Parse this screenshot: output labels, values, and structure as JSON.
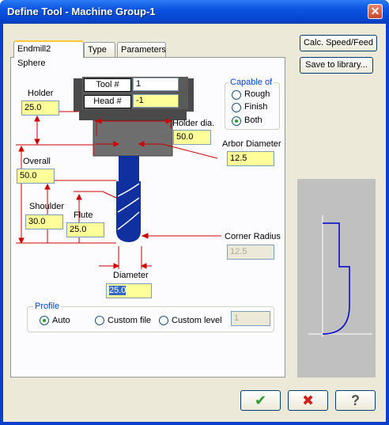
{
  "window": {
    "title": "Define Tool - Machine Group-1",
    "close_glyph": "✕"
  },
  "tabs": [
    {
      "label": "Endmill2 Sphere",
      "active": true
    },
    {
      "label": "Type",
      "active": false
    },
    {
      "label": "Parameters",
      "active": false
    }
  ],
  "tool_diagram": {
    "tool_number_label": "Tool #",
    "tool_number": "1",
    "head_number_label": "Head #",
    "head_number": "-1",
    "holder_label": "Holder",
    "holder": "25.0",
    "holder_dia_label": "Holder dia.",
    "holder_dia": "50.0",
    "arbor_label": "Arbor Diameter",
    "arbor": "12.5",
    "overall_label": "Overall",
    "overall": "50.0",
    "shoulder_label": "Shoulder",
    "shoulder": "30.0",
    "flute_label": "Flute",
    "flute": "25.0",
    "corner_radius_label": "Corner Radius",
    "corner_radius": "12.5",
    "diameter_label": "Diameter",
    "diameter": "25.0"
  },
  "capable_of": {
    "title": "Capable of",
    "options": [
      {
        "label": "Rough",
        "selected": false
      },
      {
        "label": "Finish",
        "selected": false
      },
      {
        "label": "Both",
        "selected": true
      }
    ]
  },
  "profile": {
    "title": "Profile",
    "options": [
      {
        "label": "Auto",
        "selected": true
      },
      {
        "label": "Custom file",
        "selected": false
      },
      {
        "label": "Custom level",
        "selected": false
      }
    ],
    "custom_level_value": "1"
  },
  "side_buttons": {
    "calc_label": "Calc. Speed/Feed",
    "save_label": "Save to library..."
  },
  "bottom_buttons": {
    "ok_glyph": "✔",
    "cancel_glyph": "✖",
    "help_glyph": "?"
  },
  "colors": {
    "field_yellow": "#ffff99",
    "tool_blue": "#1030a0",
    "dim_red": "#cc0000",
    "preview_bg": "#c0c0c0",
    "profile_blue": "#0000cc"
  }
}
